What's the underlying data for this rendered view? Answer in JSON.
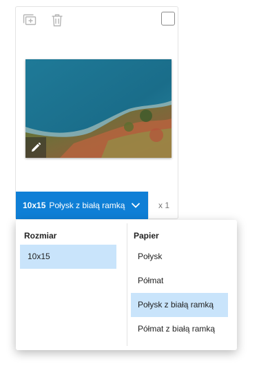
{
  "card": {
    "tools": [
      {
        "name": "copy-photo-icon"
      },
      {
        "name": "trash-icon"
      }
    ],
    "option_bar": {
      "size": "10x15",
      "paper": "Połysk z białą ramką"
    },
    "quantity": "x 1"
  },
  "dropdown": {
    "size_column": {
      "heading": "Rozmiar",
      "options": [
        {
          "label": "10x15",
          "selected": true
        }
      ]
    },
    "paper_column": {
      "heading": "Papier",
      "options": [
        {
          "label": "Połysk",
          "selected": false
        },
        {
          "label": "Półmat",
          "selected": false
        },
        {
          "label": "Połysk z białą ramką",
          "selected": true
        },
        {
          "label": "Półmat z białą ramką",
          "selected": false
        }
      ]
    }
  },
  "colors": {
    "accent": "#0f7fd6",
    "selected_option": "#c9e4fb"
  }
}
